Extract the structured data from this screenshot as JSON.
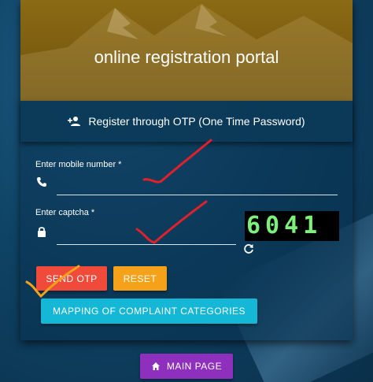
{
  "banner": {
    "title": "online registration portal"
  },
  "subheader": {
    "icon": "person-add-icon",
    "text": "Register through OTP (One Time Password)"
  },
  "mobile": {
    "label": "Enter mobile number *",
    "icon": "phone-icon",
    "value": "",
    "placeholder": ""
  },
  "captcha": {
    "label": "Enter captcha *",
    "icon": "lock-icon",
    "value": "",
    "placeholder": "",
    "code": "6041",
    "refresh_icon": "refresh-icon"
  },
  "buttons": {
    "send_otp": "SEND OTP",
    "reset": "RESET",
    "mapping": "MAPPING OF COMPLAINT CATEGORIES",
    "main_page": "MAIN PAGE",
    "main_page_icon": "home-icon"
  },
  "colors": {
    "banner": "#7a5c10",
    "send_otp": "#f04a3a",
    "reset": "#f5a21a",
    "mapping": "#14b8d6",
    "main_page": "#8f2fbd",
    "captcha_text": "#7cf07a",
    "annotation_red": "#e0202a",
    "annotation_orange": "#f5a21a"
  }
}
